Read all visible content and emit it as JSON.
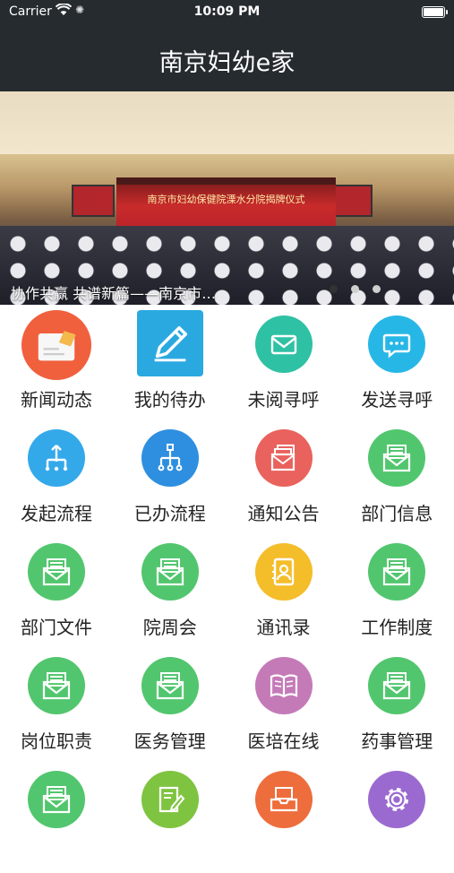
{
  "status_bar": {
    "carrier": "Carrier",
    "time": "10:09 PM"
  },
  "nav": {
    "title": "南京妇幼e家"
  },
  "banner": {
    "caption": "协作共赢 共谱新篇——南京市…",
    "stage_text": "南京市妇幼保健院溧水分院揭牌仪式",
    "page_count": 3,
    "active_page": 1
  },
  "menu": [
    {
      "label": "新闻动态",
      "icon": "news-card-icon",
      "color": "#f0603d"
    },
    {
      "label": "我的待办",
      "icon": "pencil-icon",
      "color": "#2aa9e0"
    },
    {
      "label": "未阅寻呼",
      "icon": "mail-icon",
      "color": "#2fc1a4"
    },
    {
      "label": "发送寻呼",
      "icon": "chat-bubble-icon",
      "color": "#27b7e6"
    },
    {
      "label": "发起流程",
      "icon": "flow-up-icon",
      "color": "#34a9ea"
    },
    {
      "label": "已办流程",
      "icon": "flow-tree-icon",
      "color": "#2e8fe0"
    },
    {
      "label": "通知公告",
      "icon": "stacked-mail-icon",
      "color": "#e9625d"
    },
    {
      "label": "部门信息",
      "icon": "letter-icon",
      "color": "#52c66e"
    },
    {
      "label": "部门文件",
      "icon": "letter-icon",
      "color": "#52c66e"
    },
    {
      "label": "院周会",
      "icon": "letter-icon",
      "color": "#52c66e"
    },
    {
      "label": "通讯录",
      "icon": "contacts-icon",
      "color": "#f4bd2a"
    },
    {
      "label": "工作制度",
      "icon": "letter-icon",
      "color": "#52c66e"
    },
    {
      "label": "岗位职责",
      "icon": "letter-icon",
      "color": "#52c66e"
    },
    {
      "label": "医务管理",
      "icon": "letter-icon",
      "color": "#52c66e"
    },
    {
      "label": "医培在线",
      "icon": "book-icon",
      "color": "#c57ab8"
    },
    {
      "label": "药事管理",
      "icon": "letter-icon",
      "color": "#52c66e"
    },
    {
      "label": "",
      "icon": "letter-icon",
      "color": "#52c66e"
    },
    {
      "label": "",
      "icon": "edit-doc-icon",
      "color": "#7fc440"
    },
    {
      "label": "",
      "icon": "tray-icon",
      "color": "#ee6d3c"
    },
    {
      "label": "",
      "icon": "gear-icon",
      "color": "#9b6ad0"
    }
  ]
}
